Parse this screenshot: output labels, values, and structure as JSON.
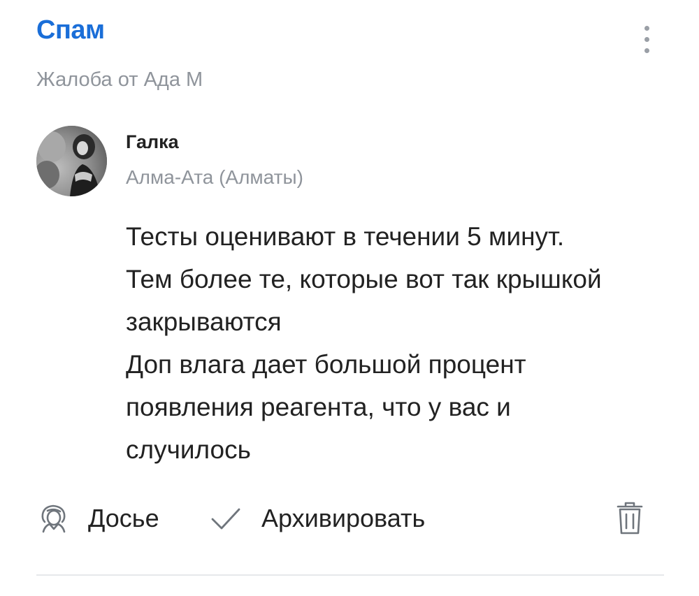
{
  "header": {
    "title": "Спам",
    "more_icon": "more-vertical-icon"
  },
  "complaint": {
    "text": "Жалоба от Ада М"
  },
  "post": {
    "author": {
      "name": "Галка",
      "city": "Алма-Ата (Алматы)"
    },
    "message_lines": [
      "Тесты оценивают в течении 5 минут.",
      "Тем более те, которые вот так крышкой",
      "закрываются",
      "Доп влага дает большой процент",
      "появления реагента, что у вас и",
      "случилось"
    ]
  },
  "actions": {
    "dossier_label": "Досье",
    "dossier_icon": "user-profile-icon",
    "archive_label": "Архивировать",
    "archive_icon": "checkmark-icon",
    "delete_icon": "trash-icon"
  },
  "colors": {
    "accent": "#1a6ed8",
    "muted_text": "#8f949b",
    "body_text": "#222222",
    "icon_gray": "#9a9fa6",
    "divider": "#e6e8eb"
  }
}
